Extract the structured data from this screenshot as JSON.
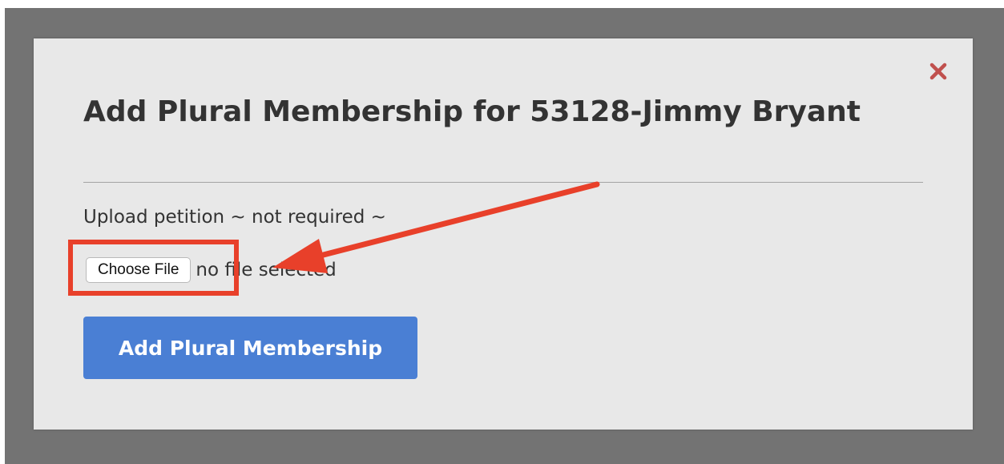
{
  "modal": {
    "title": "Add Plural Membership for 53128-Jimmy Bryant",
    "close_icon": "close-x-icon",
    "upload_label": "Upload petition ~ not required ~",
    "file_input": {
      "button_label": "Choose File",
      "status_text": "no file selected"
    },
    "submit_label": "Add Plural Membership"
  },
  "annotation": {
    "color": "#e8402a",
    "highlight_target": "choose-file-button",
    "arrow_target": "choose-file-button"
  },
  "colors": {
    "overlay": "#737373",
    "modal_background": "#e8e8e8",
    "primary_button": "#4a7fd4",
    "close_icon": "#c0504d",
    "title_text": "#333333"
  }
}
